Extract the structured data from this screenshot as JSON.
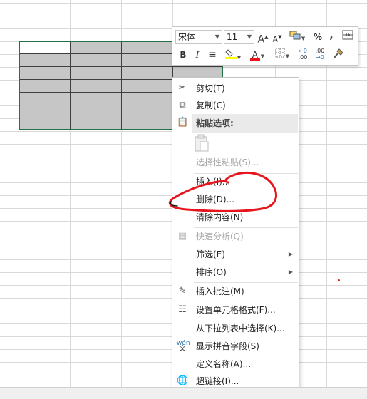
{
  "minibar": {
    "font_name": "宋体",
    "font_size": "11",
    "grow_font": "A",
    "shrink_font": "A",
    "percent_style": "%",
    "comma_style": ",",
    "bold": "B",
    "italic": "I",
    "align_center": "≡",
    "font_color_letter": "A",
    "increase_decimal": ".00",
    "decrease_decimal": ".00"
  },
  "menu": {
    "cut": "剪切(T)",
    "copy": "复制(C)",
    "paste_options": "粘贴选项:",
    "paste_special": "选择性粘贴(S)...",
    "insert": "插入(I)...",
    "delete": "删除(D)...",
    "clear_contents": "清除内容(N)",
    "quick_analysis": "快速分析(Q)",
    "filter": "筛选(E)",
    "sort": "排序(O)",
    "insert_comment": "插入批注(M)",
    "format_cells": "设置单元格格式(F)...",
    "pick_from_list": "从下拉列表中选择(K)...",
    "show_phonetic": "显示拼音字段(S)",
    "define_name": "定义名称(A)...",
    "hyperlink": "超链接(I)..."
  },
  "colors": {
    "selection_border": "#217346",
    "selection_fill": "#c6c6c6",
    "annotation": "#e8141c",
    "font_color_bar": "#e8141c",
    "fill_color_bar": "#ffff00"
  }
}
